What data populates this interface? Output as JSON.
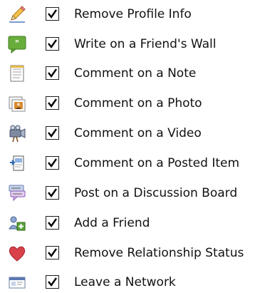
{
  "permissions": [
    {
      "label": "Remove Profile Info",
      "checked": true,
      "icon": "pencil-edit-icon"
    },
    {
      "label": "Write on a Friend's Wall",
      "checked": true,
      "icon": "speech-bubble-icon"
    },
    {
      "label": "Comment on a Note",
      "checked": true,
      "icon": "note-icon"
    },
    {
      "label": "Comment on a Photo",
      "checked": true,
      "icon": "photo-icon"
    },
    {
      "label": "Comment on a Video",
      "checked": true,
      "icon": "video-camera-icon"
    },
    {
      "label": "Comment on a Posted Item",
      "checked": true,
      "icon": "posted-item-icon"
    },
    {
      "label": "Post on a Discussion Board",
      "checked": true,
      "icon": "discussion-board-icon"
    },
    {
      "label": "Add a Friend",
      "checked": true,
      "icon": "add-friend-icon"
    },
    {
      "label": "Remove Relationship Status",
      "checked": true,
      "icon": "heart-icon"
    },
    {
      "label": "Leave a Network",
      "checked": true,
      "icon": "network-icon"
    }
  ],
  "colors": {
    "text": "#111111",
    "checkbox_border": "#1c1c1c",
    "check_mark": "#000000",
    "heart": "#d9414a",
    "bubble": "#69ae3c"
  }
}
